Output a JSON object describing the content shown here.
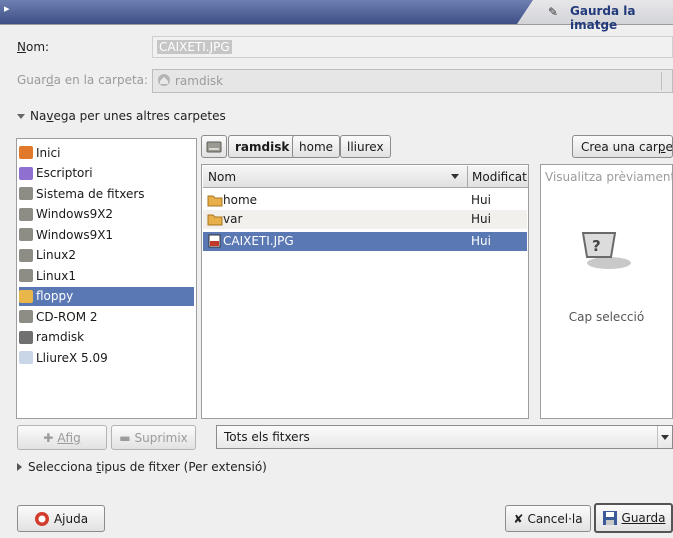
{
  "titlebar": {
    "title": "Gaurda la imatge"
  },
  "name_row": {
    "label": "Nom:",
    "value": "CAIXETI.JPG"
  },
  "folder_row": {
    "label": "Guarda en la carpeta:",
    "value": "ramdisk"
  },
  "browse_expander": {
    "label": "Navega per unes altres carpetes"
  },
  "path_bar": {
    "buttons": [
      "ramdisk",
      "home",
      "lliurex"
    ]
  },
  "create_folder": {
    "label": "Crea una carpeta"
  },
  "places": [
    {
      "label": "Inici",
      "icon": "home-icon",
      "color": "#e07a2a"
    },
    {
      "label": "Escriptori",
      "icon": "desktop-icon",
      "color": "#8f6fd0"
    },
    {
      "label": "Sistema de fitxers",
      "icon": "drive-icon",
      "color": "#8d8d86"
    },
    {
      "label": "Windows9X2",
      "icon": "drive-icon",
      "color": "#8d8d86"
    },
    {
      "label": "Windows9X1",
      "icon": "drive-icon",
      "color": "#8d8d86"
    },
    {
      "label": "Linux2",
      "icon": "drive-icon",
      "color": "#8d8d86"
    },
    {
      "label": "Linux1",
      "icon": "drive-icon",
      "color": "#8d8d86"
    },
    {
      "label": "floppy",
      "icon": "floppy-icon",
      "color": "#e9b64a"
    },
    {
      "label": "CD-ROM 2",
      "icon": "drive-icon",
      "color": "#8d8d86"
    },
    {
      "label": "ramdisk",
      "icon": "ramdisk-icon",
      "color": "#707070"
    },
    {
      "label": "LliureX 5.09",
      "icon": "cdrom-icon",
      "color": "#c9d6e8"
    }
  ],
  "places_selected": "floppy",
  "file_list": {
    "col_name": "Nom",
    "col_modified": "Modificat",
    "rows": [
      {
        "name": "home",
        "modified": "Hui",
        "icon": "folder-icon"
      },
      {
        "name": "var",
        "modified": "Hui",
        "icon": "folder-icon"
      },
      {
        "name": "CAIXETI.JPG",
        "modified": "Hui",
        "icon": "image-file-icon"
      }
    ],
    "selected": "CAIXETI.JPG"
  },
  "preview": {
    "title": "Visualitza prèviament",
    "empty_text": "Cap selecció"
  },
  "buttons": {
    "add": "Afig",
    "remove": "Suprimix",
    "help": "Ajuda",
    "cancel": "Cancel·la",
    "save": "Guarda"
  },
  "filter": {
    "value": "Tots els fitxers"
  },
  "type_expander": {
    "label": "Selecciona tipus de fitxer (Per extensió)"
  },
  "colors": {
    "selection": "#5a78b4",
    "title_bar": "#3e4f86"
  }
}
